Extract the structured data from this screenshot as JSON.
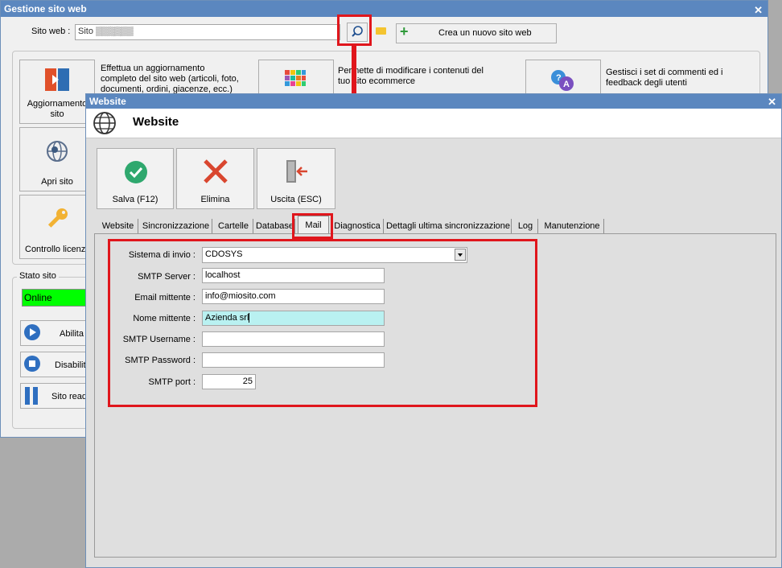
{
  "back_window": {
    "title": "Gestione sito web",
    "site_label": "Sito web :",
    "site_value": "Sito ▒▒▒▒▒▒",
    "new_site_button": "Crea un nuovo sito web",
    "update_button": "Aggiornamento sito",
    "update_desc": "Effettua un aggiornamento completo del sito web (articoli, foto, documenti, ordini, giacenze, ecc.)",
    "modify_desc": "Permette di modificare i contenuti del tuo sito ecommerce",
    "feedback_desc": "Gestisci i set di commenti ed i feedback degli utenti",
    "open_site_button": "Apri sito",
    "license_button": "Controllo licenza",
    "status_group": "Stato sito",
    "status_value": "Online",
    "enable_button": "Abilita s",
    "disable_button": "Disabilit",
    "readonly_button": "Sito read"
  },
  "front_window": {
    "title": "Website",
    "header": "Website",
    "toolbar": {
      "save": "Salva (F12)",
      "delete": "Elimina",
      "exit": "Uscita (ESC)"
    },
    "tabs": [
      "Website",
      "Sincronizzazione",
      "Cartelle",
      "Database",
      "Mail",
      "Diagnostica",
      "Dettagli ultima sincronizzazione",
      "Log",
      "Manutenzione"
    ],
    "form": {
      "sistema_label": "Sistema di invio :",
      "sistema_value": "CDOSYS",
      "smtp_server_label": "SMTP Server :",
      "smtp_server_value": "localhost",
      "email_label": "Email mittente :",
      "email_value": "info@miosito.com",
      "nome_label": "Nome mittente :",
      "nome_value": "Azienda srl",
      "username_label": "SMTP Username :",
      "username_value": "",
      "password_label": "SMTP Password :",
      "password_value": "",
      "port_label": "SMTP port :",
      "port_value": "25"
    }
  },
  "colors": {
    "titlebar": "#5b87bf",
    "highlight_red": "#e0161c",
    "online_green": "#00ff00",
    "selected_field": "#b9f1f1"
  }
}
